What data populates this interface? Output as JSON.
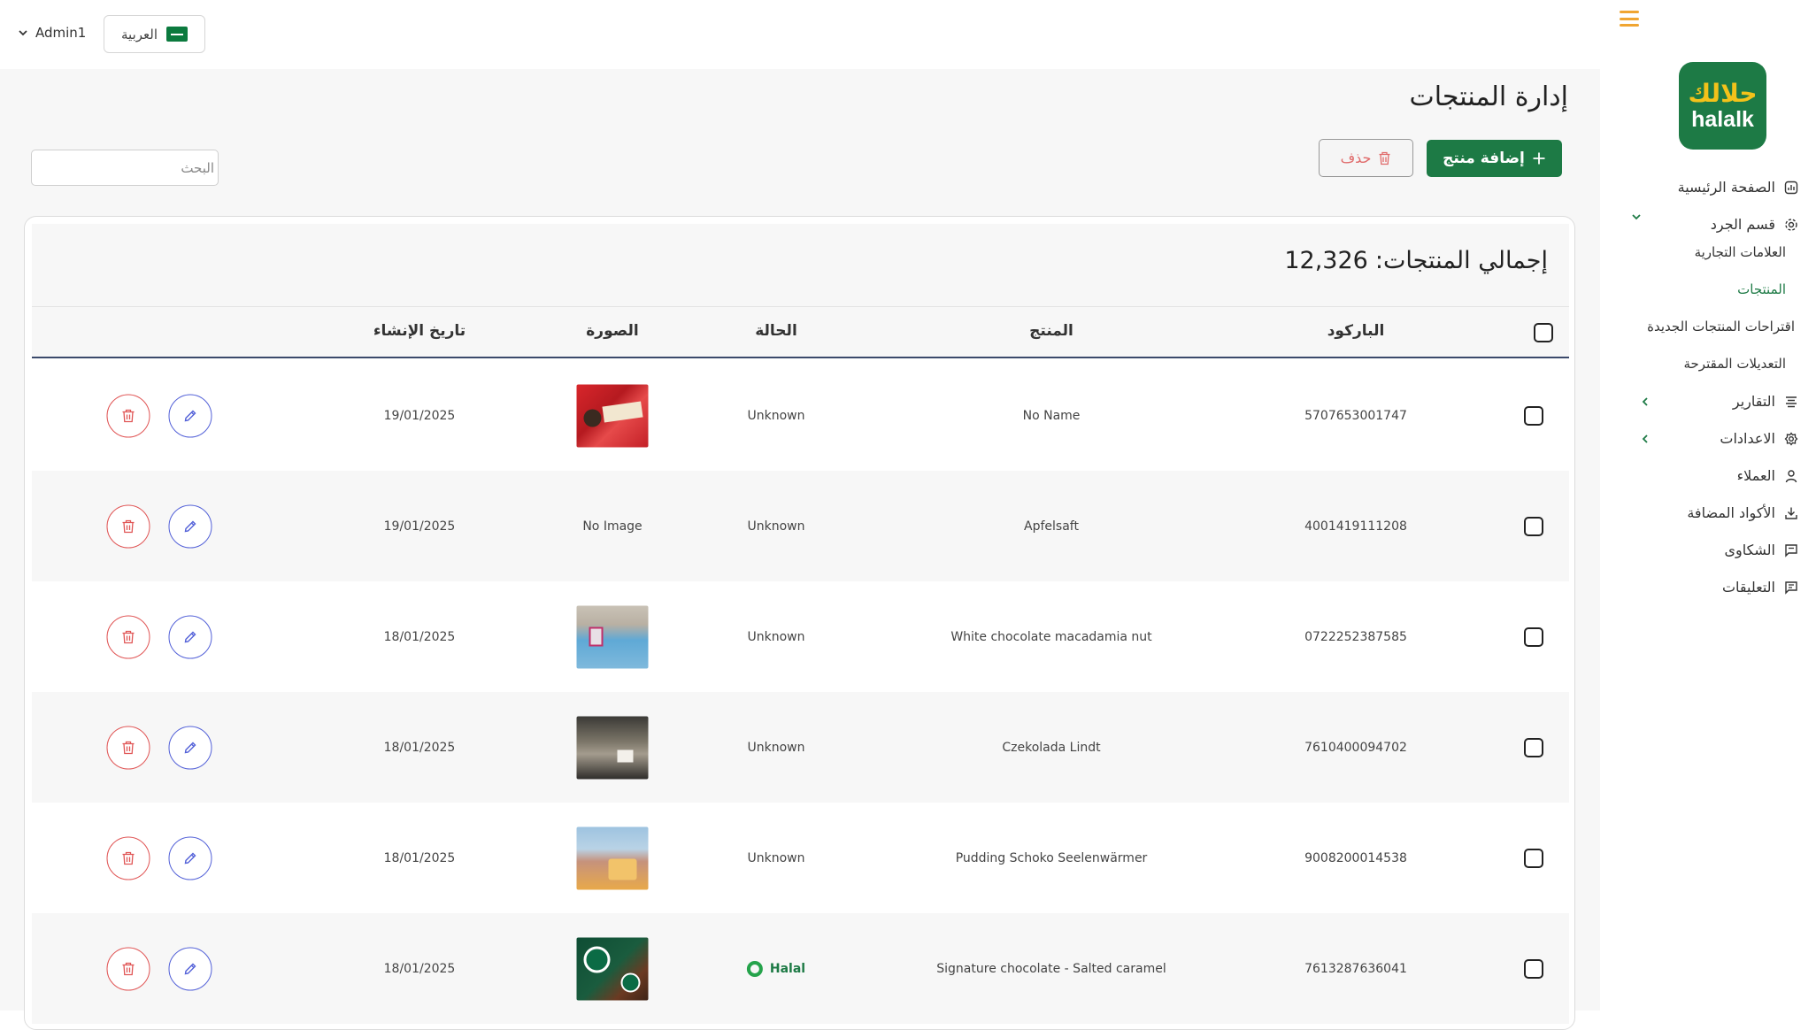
{
  "header": {
    "user": "Admin1",
    "language": "العربية"
  },
  "brand": {
    "logo_ar": "حلالك",
    "logo_en": "halalk"
  },
  "sidebar": {
    "items": [
      {
        "label": "الصفحة الرئيسية",
        "icon": "dashboard-icon"
      },
      {
        "label": "قسم الجرد",
        "icon": "inventory-icon"
      },
      {
        "label": "العلامات التجارية"
      },
      {
        "label": "المنتجات"
      },
      {
        "label": "اقتراحات المنتجات الجديدة"
      },
      {
        "label": "التعديلات المقترحة"
      },
      {
        "label": "التقارير",
        "icon": "reports-icon"
      },
      {
        "label": "الاعدادات",
        "icon": "settings-icon"
      },
      {
        "label": "العملاء",
        "icon": "user-icon"
      },
      {
        "label": "الأكواد المضافة",
        "icon": "download-icon"
      },
      {
        "label": "الشكاوى",
        "icon": "message-icon"
      },
      {
        "label": "التعليقات",
        "icon": "comment-icon"
      }
    ]
  },
  "page": {
    "title": "إدارة المنتجات",
    "add_label": "إضافة منتج",
    "delete_label": "حذف",
    "search_placeholder": "البحث",
    "total_label": "إجمالي المنتجات:",
    "total_value": "12,326"
  },
  "colors": {
    "brand_green": "#1d7a45",
    "accent_orange": "#f0a531",
    "edit_blue": "#5361d8",
    "delete_red": "#e05555"
  },
  "table": {
    "columns": {
      "barcode": "الباركود",
      "product": "المنتج",
      "status": "الحالة",
      "image": "الصورة",
      "created": "تاريخ الإنشاء"
    },
    "rows": [
      {
        "barcode": "5707653001747",
        "product": "No Name",
        "status": "Unknown",
        "image": "",
        "date": "19/01/2025"
      },
      {
        "barcode": "4001419111208",
        "product": "Apfelsaft",
        "status": "Unknown",
        "image": "No Image",
        "date": "19/01/2025"
      },
      {
        "barcode": "0722252387585",
        "product": "White chocolate macadamia nut",
        "status": "Unknown",
        "image": "",
        "date": "18/01/2025"
      },
      {
        "barcode": "7610400094702",
        "product": "Czekolada Lindt",
        "status": "Unknown",
        "image": "",
        "date": "18/01/2025"
      },
      {
        "barcode": "9008200014538",
        "product": "Pudding Schoko Seelenwärmer",
        "status": "Unknown",
        "image": "",
        "date": "18/01/2025"
      },
      {
        "barcode": "7613287636041",
        "product": "Signature chocolate - Salted caramel",
        "status": "Halal",
        "image": "",
        "date": "18/01/2025"
      }
    ]
  }
}
